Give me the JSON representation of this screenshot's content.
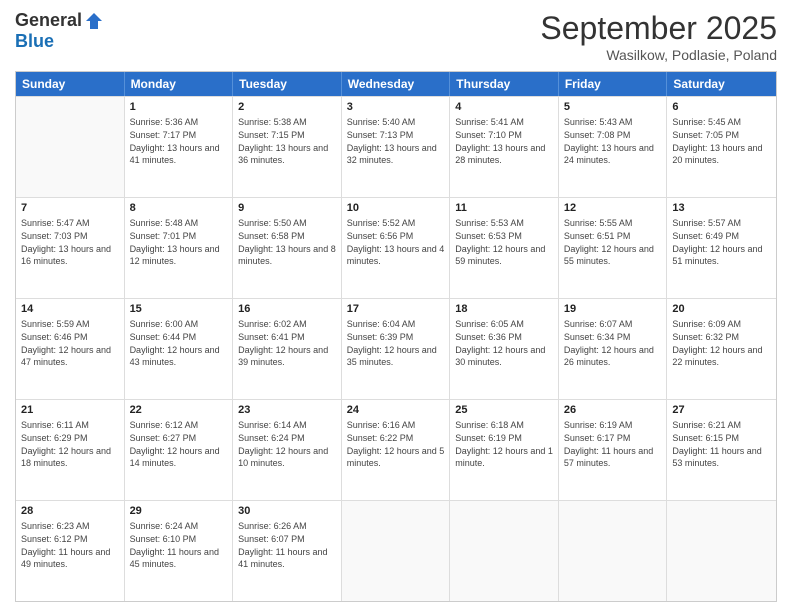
{
  "logo": {
    "general": "General",
    "blue": "Blue"
  },
  "header": {
    "title": "September 2025",
    "location": "Wasilkow, Podlasie, Poland"
  },
  "days": [
    "Sunday",
    "Monday",
    "Tuesday",
    "Wednesday",
    "Thursday",
    "Friday",
    "Saturday"
  ],
  "weeks": [
    [
      {
        "day": "",
        "sunrise": "",
        "sunset": "",
        "daylight": ""
      },
      {
        "day": "1",
        "sunrise": "Sunrise: 5:36 AM",
        "sunset": "Sunset: 7:17 PM",
        "daylight": "Daylight: 13 hours and 41 minutes."
      },
      {
        "day": "2",
        "sunrise": "Sunrise: 5:38 AM",
        "sunset": "Sunset: 7:15 PM",
        "daylight": "Daylight: 13 hours and 36 minutes."
      },
      {
        "day": "3",
        "sunrise": "Sunrise: 5:40 AM",
        "sunset": "Sunset: 7:13 PM",
        "daylight": "Daylight: 13 hours and 32 minutes."
      },
      {
        "day": "4",
        "sunrise": "Sunrise: 5:41 AM",
        "sunset": "Sunset: 7:10 PM",
        "daylight": "Daylight: 13 hours and 28 minutes."
      },
      {
        "day": "5",
        "sunrise": "Sunrise: 5:43 AM",
        "sunset": "Sunset: 7:08 PM",
        "daylight": "Daylight: 13 hours and 24 minutes."
      },
      {
        "day": "6",
        "sunrise": "Sunrise: 5:45 AM",
        "sunset": "Sunset: 7:05 PM",
        "daylight": "Daylight: 13 hours and 20 minutes."
      }
    ],
    [
      {
        "day": "7",
        "sunrise": "Sunrise: 5:47 AM",
        "sunset": "Sunset: 7:03 PM",
        "daylight": "Daylight: 13 hours and 16 minutes."
      },
      {
        "day": "8",
        "sunrise": "Sunrise: 5:48 AM",
        "sunset": "Sunset: 7:01 PM",
        "daylight": "Daylight: 13 hours and 12 minutes."
      },
      {
        "day": "9",
        "sunrise": "Sunrise: 5:50 AM",
        "sunset": "Sunset: 6:58 PM",
        "daylight": "Daylight: 13 hours and 8 minutes."
      },
      {
        "day": "10",
        "sunrise": "Sunrise: 5:52 AM",
        "sunset": "Sunset: 6:56 PM",
        "daylight": "Daylight: 13 hours and 4 minutes."
      },
      {
        "day": "11",
        "sunrise": "Sunrise: 5:53 AM",
        "sunset": "Sunset: 6:53 PM",
        "daylight": "Daylight: 12 hours and 59 minutes."
      },
      {
        "day": "12",
        "sunrise": "Sunrise: 5:55 AM",
        "sunset": "Sunset: 6:51 PM",
        "daylight": "Daylight: 12 hours and 55 minutes."
      },
      {
        "day": "13",
        "sunrise": "Sunrise: 5:57 AM",
        "sunset": "Sunset: 6:49 PM",
        "daylight": "Daylight: 12 hours and 51 minutes."
      }
    ],
    [
      {
        "day": "14",
        "sunrise": "Sunrise: 5:59 AM",
        "sunset": "Sunset: 6:46 PM",
        "daylight": "Daylight: 12 hours and 47 minutes."
      },
      {
        "day": "15",
        "sunrise": "Sunrise: 6:00 AM",
        "sunset": "Sunset: 6:44 PM",
        "daylight": "Daylight: 12 hours and 43 minutes."
      },
      {
        "day": "16",
        "sunrise": "Sunrise: 6:02 AM",
        "sunset": "Sunset: 6:41 PM",
        "daylight": "Daylight: 12 hours and 39 minutes."
      },
      {
        "day": "17",
        "sunrise": "Sunrise: 6:04 AM",
        "sunset": "Sunset: 6:39 PM",
        "daylight": "Daylight: 12 hours and 35 minutes."
      },
      {
        "day": "18",
        "sunrise": "Sunrise: 6:05 AM",
        "sunset": "Sunset: 6:36 PM",
        "daylight": "Daylight: 12 hours and 30 minutes."
      },
      {
        "day": "19",
        "sunrise": "Sunrise: 6:07 AM",
        "sunset": "Sunset: 6:34 PM",
        "daylight": "Daylight: 12 hours and 26 minutes."
      },
      {
        "day": "20",
        "sunrise": "Sunrise: 6:09 AM",
        "sunset": "Sunset: 6:32 PM",
        "daylight": "Daylight: 12 hours and 22 minutes."
      }
    ],
    [
      {
        "day": "21",
        "sunrise": "Sunrise: 6:11 AM",
        "sunset": "Sunset: 6:29 PM",
        "daylight": "Daylight: 12 hours and 18 minutes."
      },
      {
        "day": "22",
        "sunrise": "Sunrise: 6:12 AM",
        "sunset": "Sunset: 6:27 PM",
        "daylight": "Daylight: 12 hours and 14 minutes."
      },
      {
        "day": "23",
        "sunrise": "Sunrise: 6:14 AM",
        "sunset": "Sunset: 6:24 PM",
        "daylight": "Daylight: 12 hours and 10 minutes."
      },
      {
        "day": "24",
        "sunrise": "Sunrise: 6:16 AM",
        "sunset": "Sunset: 6:22 PM",
        "daylight": "Daylight: 12 hours and 5 minutes."
      },
      {
        "day": "25",
        "sunrise": "Sunrise: 6:18 AM",
        "sunset": "Sunset: 6:19 PM",
        "daylight": "Daylight: 12 hours and 1 minute."
      },
      {
        "day": "26",
        "sunrise": "Sunrise: 6:19 AM",
        "sunset": "Sunset: 6:17 PM",
        "daylight": "Daylight: 11 hours and 57 minutes."
      },
      {
        "day": "27",
        "sunrise": "Sunrise: 6:21 AM",
        "sunset": "Sunset: 6:15 PM",
        "daylight": "Daylight: 11 hours and 53 minutes."
      }
    ],
    [
      {
        "day": "28",
        "sunrise": "Sunrise: 6:23 AM",
        "sunset": "Sunset: 6:12 PM",
        "daylight": "Daylight: 11 hours and 49 minutes."
      },
      {
        "day": "29",
        "sunrise": "Sunrise: 6:24 AM",
        "sunset": "Sunset: 6:10 PM",
        "daylight": "Daylight: 11 hours and 45 minutes."
      },
      {
        "day": "30",
        "sunrise": "Sunrise: 6:26 AM",
        "sunset": "Sunset: 6:07 PM",
        "daylight": "Daylight: 11 hours and 41 minutes."
      },
      {
        "day": "",
        "sunrise": "",
        "sunset": "",
        "daylight": ""
      },
      {
        "day": "",
        "sunrise": "",
        "sunset": "",
        "daylight": ""
      },
      {
        "day": "",
        "sunrise": "",
        "sunset": "",
        "daylight": ""
      },
      {
        "day": "",
        "sunrise": "",
        "sunset": "",
        "daylight": ""
      }
    ]
  ]
}
